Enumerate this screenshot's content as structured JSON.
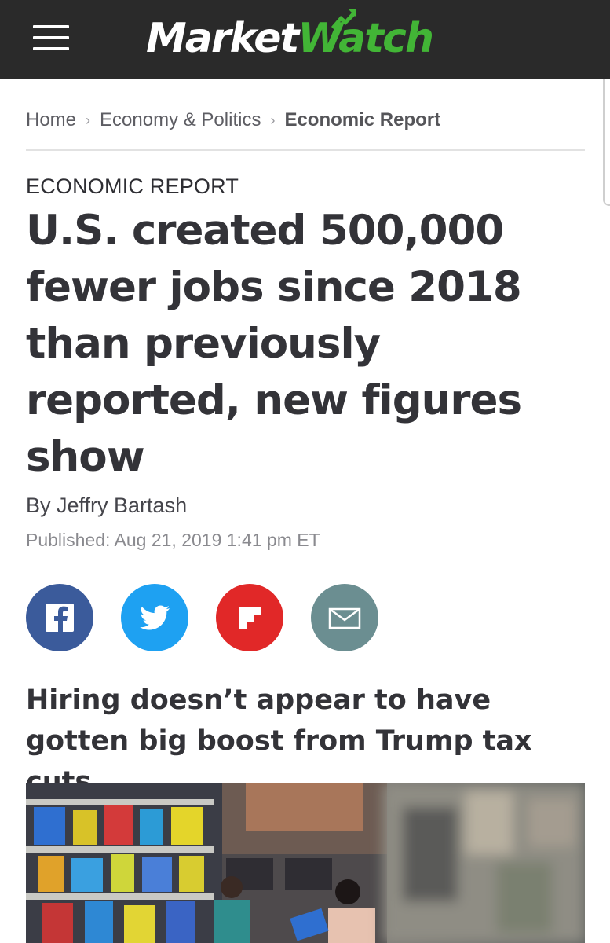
{
  "header": {
    "logo_market": "Market",
    "logo_watch": "Watch",
    "menu_icon": "hamburger-menu-icon"
  },
  "breadcrumb": {
    "items": [
      {
        "label": "Home"
      },
      {
        "label": "Economy & Politics"
      },
      {
        "label": "Economic Report"
      }
    ],
    "separator_icon": "chevron-right-icon"
  },
  "article": {
    "kicker": "ECONOMIC REPORT",
    "headline": "U.S. created 500,000 fewer jobs since 2018 than previously reported, new figures show",
    "byline": "By Jeffry Bartash",
    "published": "Published: Aug 21, 2019 1:41 pm ET",
    "subhead": "Hiring doesn’t appear to have gotten big boost from Trump tax cuts"
  },
  "share": [
    {
      "name": "facebook",
      "icon": "facebook-icon",
      "color": "#3b5b9b"
    },
    {
      "name": "twitter",
      "icon": "twitter-bird-icon",
      "color": "#1ea1f2"
    },
    {
      "name": "flipboard",
      "icon": "flipboard-icon",
      "color": "#e12828"
    },
    {
      "name": "email",
      "icon": "envelope-icon",
      "color": "#6b8e91"
    }
  ],
  "colors": {
    "topbar": "#2a2a2a",
    "brand_green": "#42b536",
    "text_dark": "#333338",
    "text_muted": "#8a8a8f"
  }
}
